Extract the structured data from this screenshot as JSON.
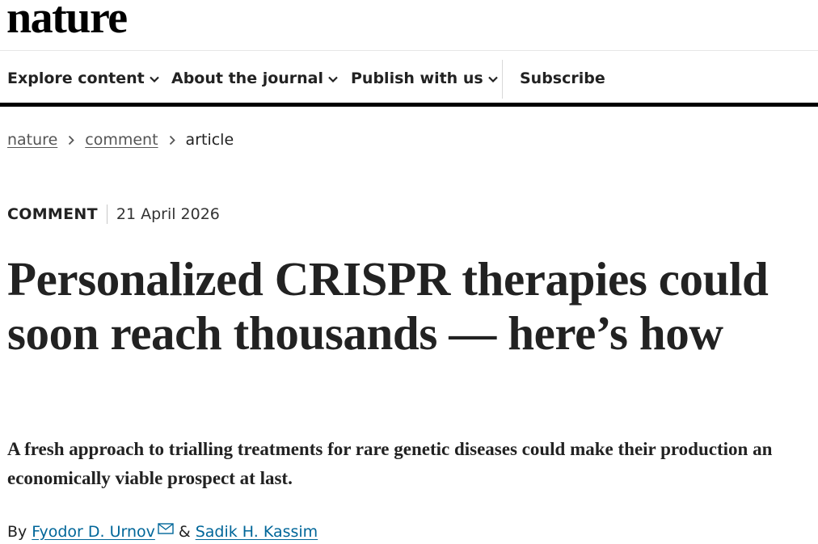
{
  "site": {
    "logo": "nature"
  },
  "nav": {
    "items": [
      {
        "label": "Explore content",
        "has_dropdown": true
      },
      {
        "label": "About the journal",
        "has_dropdown": true
      },
      {
        "label": "Publish with us",
        "has_dropdown": true
      }
    ],
    "subscribe_label": "Subscribe"
  },
  "breadcrumb": {
    "items": [
      "nature",
      "comment",
      "article"
    ]
  },
  "article": {
    "type": "COMMENT",
    "date": "21 April 2026",
    "title": "Personalized CRISPR therapies could soon reach thousands — here’s how",
    "standfirst": "A fresh approach to trialling treatments for rare genetic diseases could make their production an economically viable prospect at last.",
    "byline_prefix": "By",
    "byline_separator": "&",
    "authors": [
      {
        "name": "Fyodor D. Urnov",
        "has_email_icon": true
      },
      {
        "name": "Sadik H. Kassim"
      }
    ]
  },
  "icons": {
    "dropdown": "chevron-down-icon",
    "breadcrumb_separator": "chevron-right-icon",
    "email": "envelope-icon"
  },
  "colors": {
    "text": "#222222",
    "link": "#006699",
    "nav_rule": "#000000"
  }
}
